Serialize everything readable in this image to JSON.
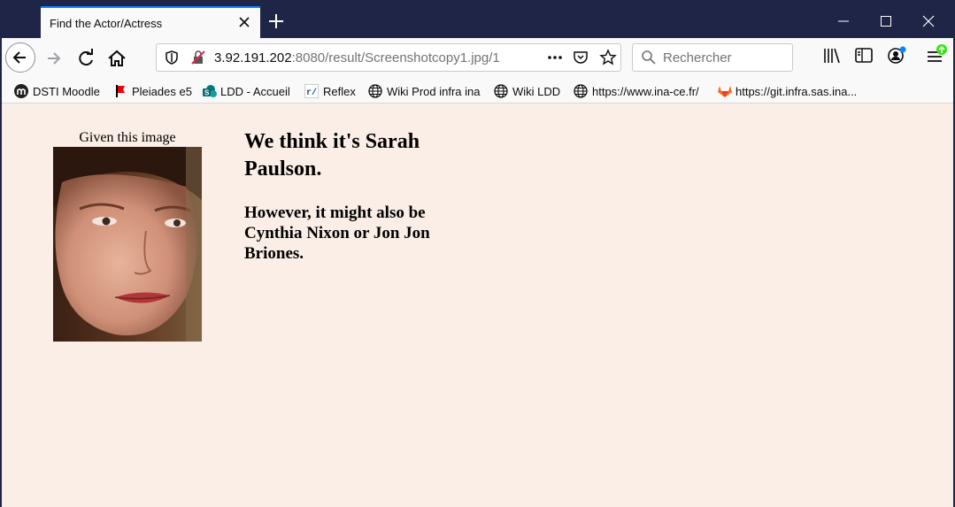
{
  "browser": {
    "tab_title": "Find the Actor/Actress",
    "url_host": "3.92.191.202",
    "url_rest": ":8080/result/Screenshotcopy1.jpg/1",
    "search_placeholder": "Rechercher"
  },
  "bookmarks": [
    {
      "label": "DSTI Moodle",
      "icon": "moodle-icon"
    },
    {
      "label": "Pleiades e5",
      "icon": "pleiades-icon"
    },
    {
      "label": "LDD - Accueil",
      "icon": "sharepoint-icon"
    },
    {
      "label": "Reflex",
      "icon": "reflex-icon"
    },
    {
      "label": "Wiki Prod infra ina",
      "icon": "globe-icon"
    },
    {
      "label": "Wiki LDD",
      "icon": "globe-icon"
    },
    {
      "label": "https://www.ina-ce.fr/",
      "icon": "globe-icon"
    },
    {
      "label": "https://git.infra.sas.ina...",
      "icon": "gitlab-icon"
    }
  ],
  "page": {
    "given_label": "Given this image",
    "result_main": "We think it's Sarah Paulson.",
    "result_alt": "However, it might also be Cynthia Nixon or Jon Jon Briones."
  },
  "colors": {
    "titlebar": "#1f2547",
    "page_background": "#faeee6",
    "tab_accent": "#0a84ff"
  }
}
